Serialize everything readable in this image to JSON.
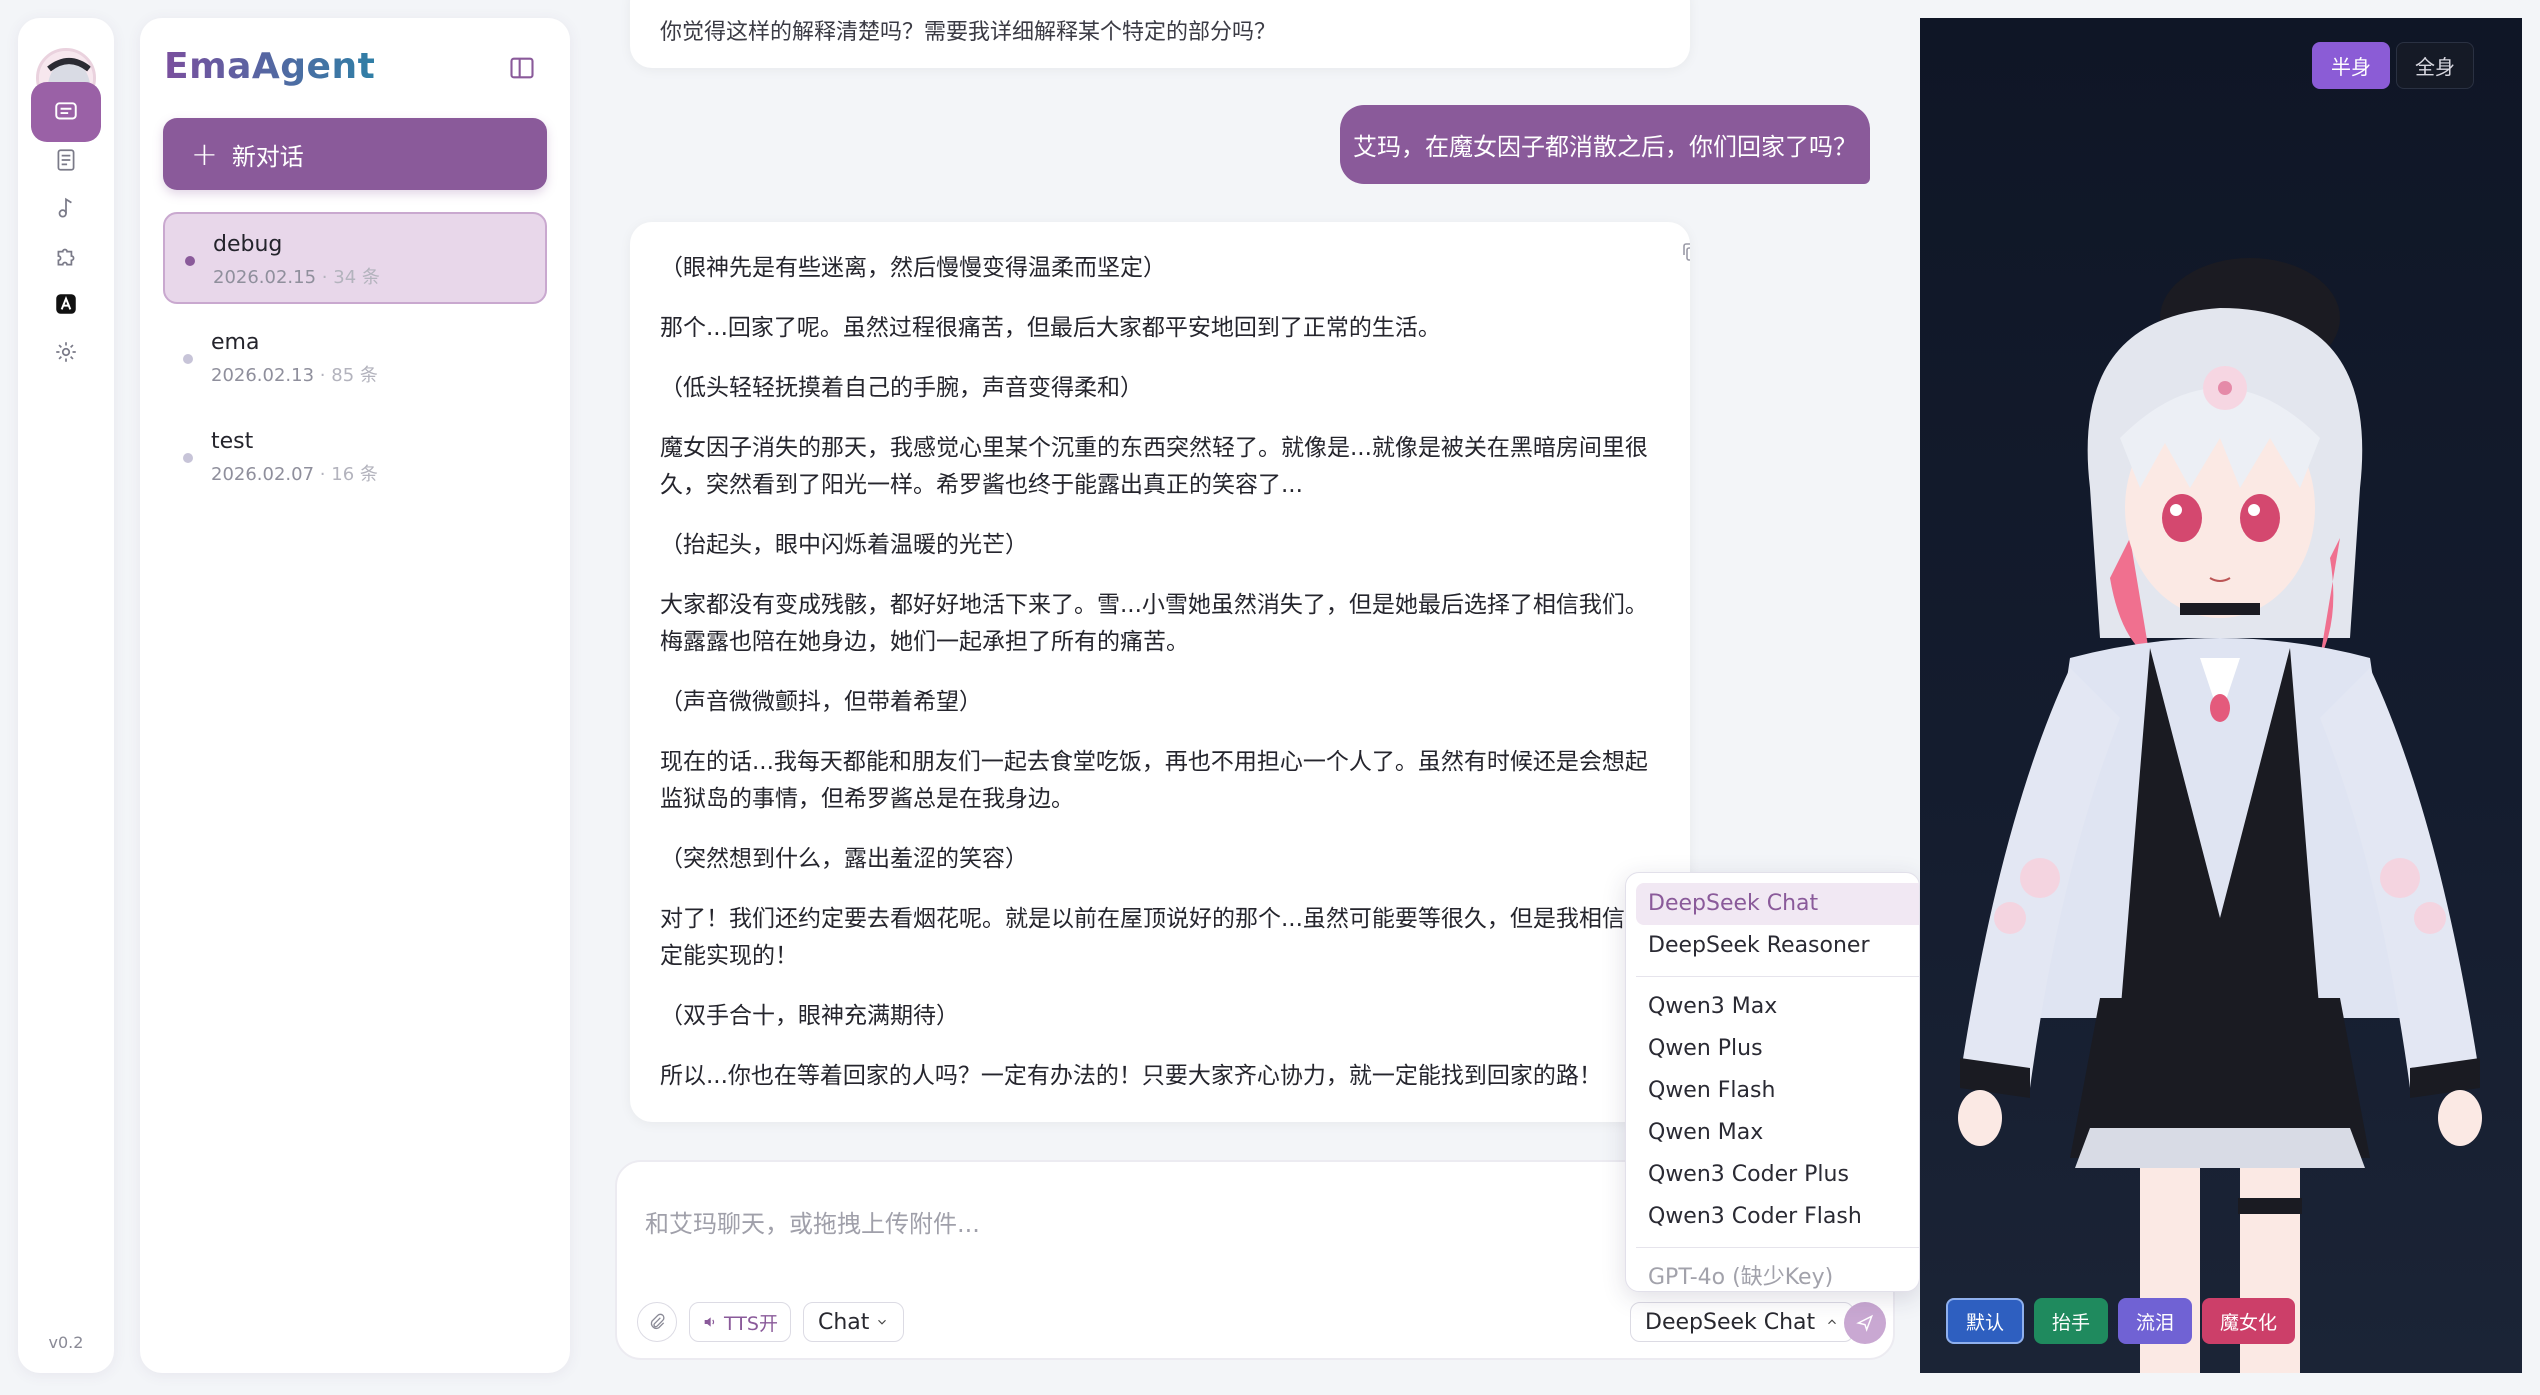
{
  "rail": {
    "nav": [
      "chat",
      "notes",
      "music",
      "plugins",
      "fonts",
      "settings"
    ],
    "version": "v0.2"
  },
  "sidebar": {
    "brand": "EmaAgent",
    "new_chat_label": "新对话",
    "conversations": [
      {
        "title": "debug",
        "date": "2026.02.15",
        "count": "· 34 条",
        "active": true
      },
      {
        "title": "ema",
        "date": "2026.02.13",
        "count": "· 85 条",
        "active": false
      },
      {
        "title": "test",
        "date": "2026.02.07",
        "count": "· 16 条",
        "active": false
      }
    ]
  },
  "chat": {
    "previous_message_tail": "你觉得这样的解释清楚吗？需要我详细解释某个特定的部分吗？",
    "user_message": "艾玛，在魔女因子都消散之后，你们回家了吗？",
    "assistant_paragraphs": [
      "（眼神先是有些迷离，然后慢慢变得温柔而坚定）",
      "那个...回家了呢。虽然过程很痛苦，但最后大家都平安地回到了正常的生活。",
      "（低头轻轻抚摸着自己的手腕，声音变得柔和）",
      "魔女因子消失的那天，我感觉心里某个沉重的东西突然轻了。就像是...就像是被关在黑暗房间里很久，突然看到了阳光一样。希罗酱也终于能露出真正的笑容了...",
      "（抬起头，眼中闪烁着温暖的光芒）",
      "大家都没有变成残骸，都好好地活下来了。雪...小雪她虽然消失了，但是她最后选择了相信我们。梅露露也陪在她身边，她们一起承担了所有的痛苦。",
      "（声音微微颤抖，但带着希望）",
      "现在的话...我每天都能和朋友们一起去食堂吃饭，再也不用担心一个人了。虽然有时候还是会想起监狱岛的事情，但希罗酱总是在我身边。",
      "（突然想到什么，露出羞涩的笑容）",
      "对了！我们还约定要去看烟花呢。就是以前在屋顶说好的那个...虽然可能要等很久，但是我相信一定能实现的！",
      "（双手合十，眼神充满期待）",
      "所以...你也在等着回家的人吗？一定有办法的！只要大家齐心协力，就一定能找到回家的路！"
    ]
  },
  "composer": {
    "placeholder": "和艾玛聊天，或拖拽上传附件...",
    "tts_label": "TTS开",
    "mode_label": "Chat",
    "model_label": "DeepSeek Chat"
  },
  "model_menu": {
    "group1": [
      "DeepSeek Chat",
      "DeepSeek Reasoner"
    ],
    "group2": [
      "Qwen3 Max",
      "Qwen Plus",
      "Qwen Flash",
      "Qwen Max",
      "Qwen3 Coder Plus",
      "Qwen3 Coder Flash"
    ],
    "group3": [
      "GPT-4o (缺少Key)"
    ],
    "selected": "DeepSeek Chat"
  },
  "stage": {
    "view_half": "半身",
    "view_full": "全身",
    "expressions": [
      "默认",
      "抬手",
      "流泪",
      "魔女化"
    ]
  },
  "colors": {
    "accent": "#8a5a9a",
    "stage_bg": "#0f1626",
    "expr_default": "#2e5fc0",
    "expr_raise": "#1f8a5e",
    "expr_tears": "#7062d4",
    "expr_witch": "#cc3f69"
  }
}
